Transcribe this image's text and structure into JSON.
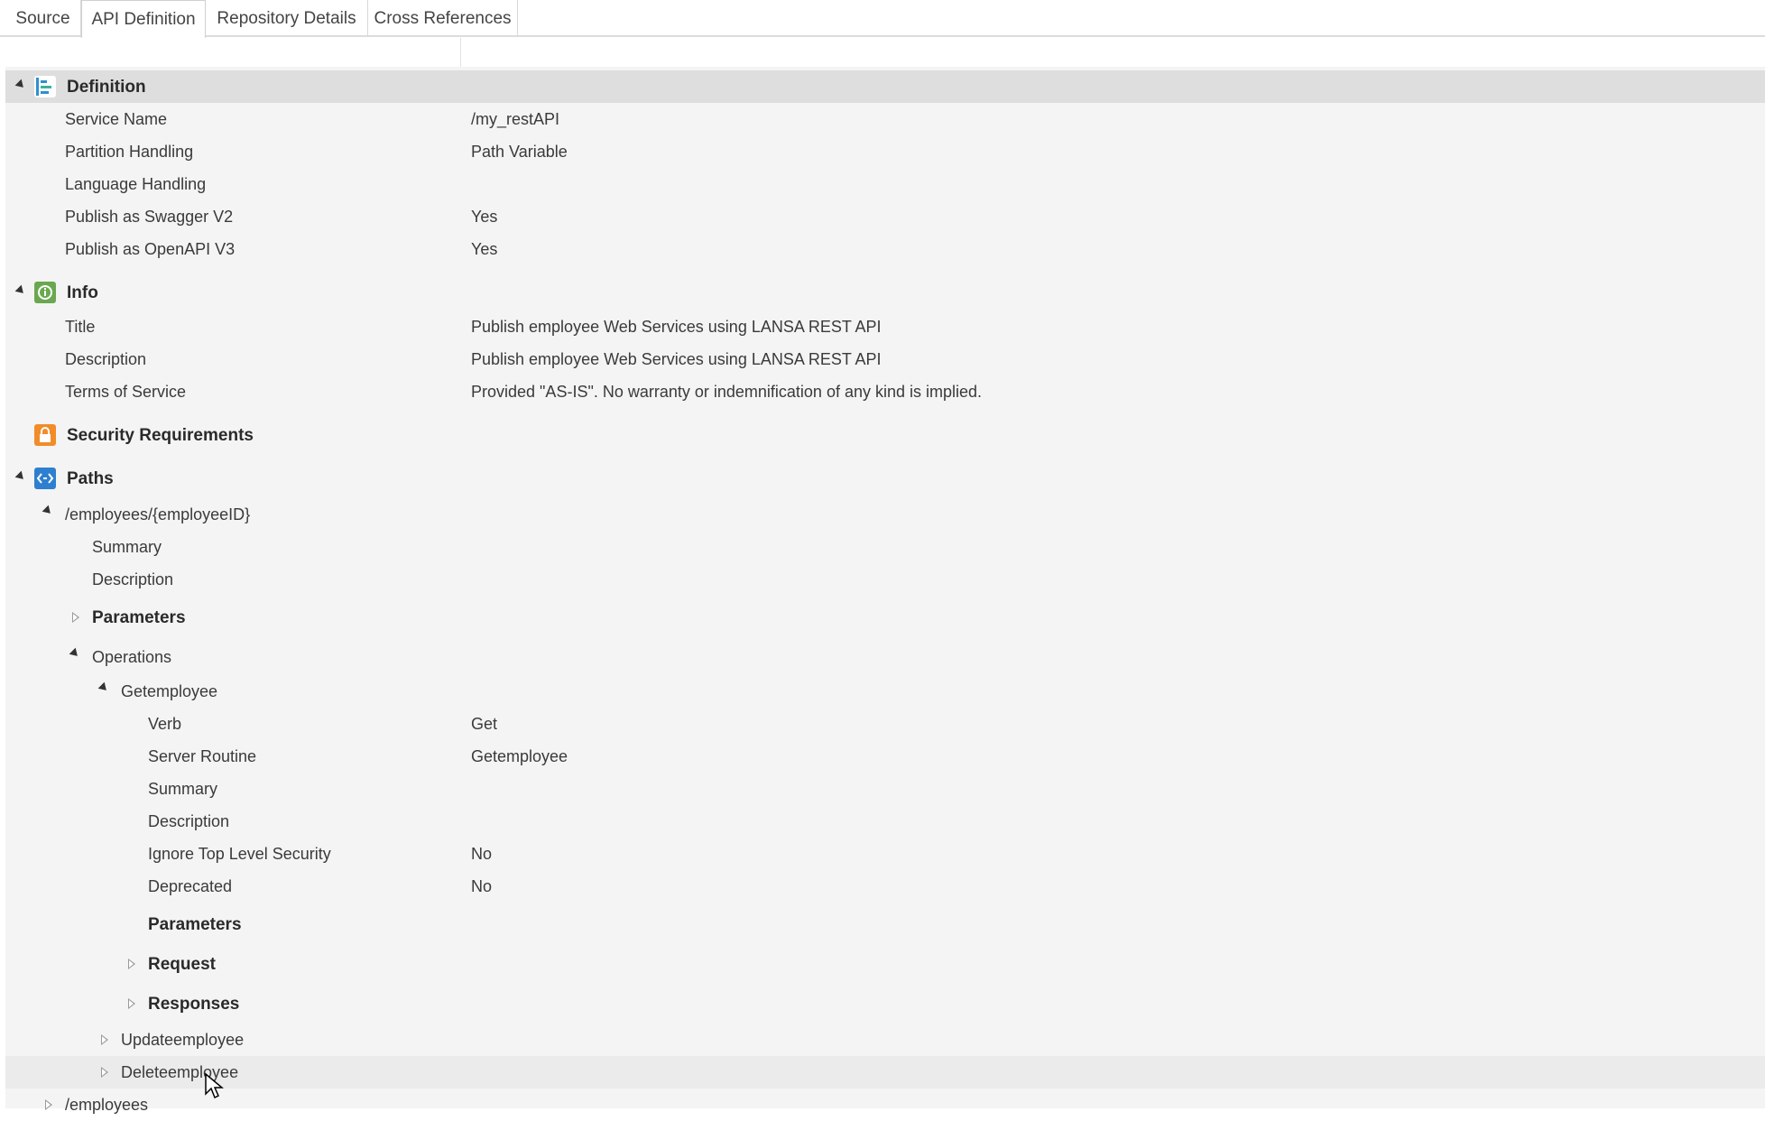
{
  "tabs": [
    {
      "label": "Source",
      "active": false
    },
    {
      "label": "API Definition",
      "active": true
    },
    {
      "label": "Repository Details",
      "active": false
    },
    {
      "label": "Cross References",
      "active": false
    }
  ],
  "definition": {
    "header": "Definition",
    "rows": [
      {
        "label": "Service Name",
        "value": "/my_restAPI"
      },
      {
        "label": "Partition Handling",
        "value": "Path Variable"
      },
      {
        "label": "Language Handling",
        "value": ""
      },
      {
        "label": "Publish as Swagger V2",
        "value": "Yes"
      },
      {
        "label": "Publish as OpenAPI V3",
        "value": "Yes"
      }
    ]
  },
  "info": {
    "header": "Info",
    "rows": [
      {
        "label": "Title",
        "value": "Publish employee Web Services using LANSA REST API"
      },
      {
        "label": "Description",
        "value": "Publish employee Web Services using LANSA REST API"
      },
      {
        "label": "Terms of Service",
        "value": "Provided \"AS-IS\". No warranty or indemnification of any kind is implied."
      }
    ]
  },
  "security": {
    "header": "Security Requirements"
  },
  "paths": {
    "header": "Paths",
    "path1": {
      "label": "/employees/{employeeID}",
      "summary": "Summary",
      "description": "Description",
      "parameters": "Parameters",
      "operations": "Operations",
      "getemployee": {
        "label": "Getemployee",
        "rows": [
          {
            "label": "Verb",
            "value": "Get"
          },
          {
            "label": "Server Routine",
            "value": "Getemployee"
          },
          {
            "label": "Summary",
            "value": ""
          },
          {
            "label": "Description",
            "value": ""
          },
          {
            "label": "Ignore Top Level Security",
            "value": "No"
          },
          {
            "label": "Deprecated",
            "value": "No"
          }
        ],
        "parameters": "Parameters",
        "request": "Request",
        "responses": "Responses"
      },
      "updateemployee": "Updateemployee",
      "deleteemployee": "Deleteemployee"
    },
    "path2": {
      "label": "/employees"
    }
  },
  "colors": {
    "definition_icon": "#2e8fcf",
    "info_icon": "#6aa84f",
    "security_icon": "#f28c28",
    "paths_icon": "#2e7fd0"
  }
}
